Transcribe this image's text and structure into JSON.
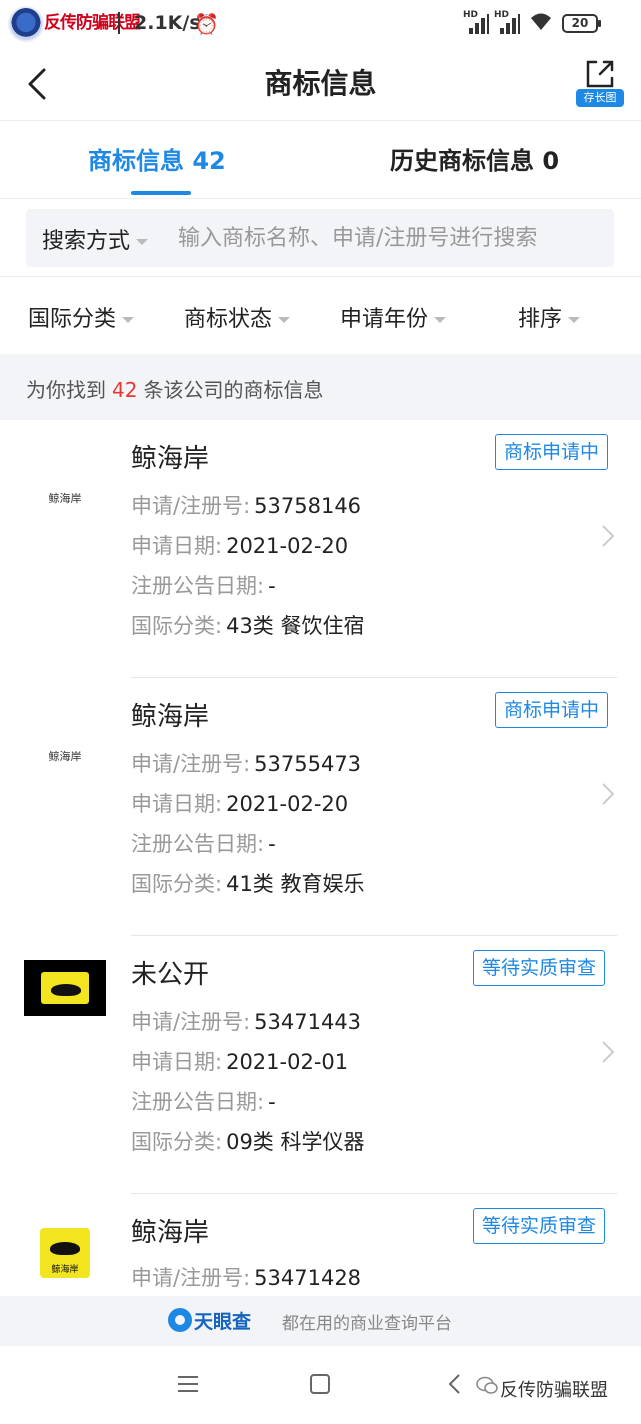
{
  "status_bar": {
    "brand": "反传防骗联盟",
    "speed": "2.1K/s",
    "alarm_icon": "alarm-clock-icon",
    "signal_label": "HD",
    "battery": "20"
  },
  "header": {
    "title": "商标信息",
    "share_label": "存长图"
  },
  "tabs": {
    "active": "商标信息 42",
    "inactive": "历史商标信息 0"
  },
  "search": {
    "mode": "搜索方式",
    "placeholder": "输入商标名称、申请/注册号进行搜索"
  },
  "filters": [
    "国际分类",
    "商标状态",
    "申请年份",
    "排序"
  ],
  "summary": {
    "prefix": "为你找到",
    "count": "42",
    "suffix": "条该公司的商标信息"
  },
  "labels": {
    "reg_no": "申请/注册号:",
    "apply_date": "申请日期:",
    "announce_date": "注册公告日期:",
    "intl_class": "国际分类:"
  },
  "items": [
    {
      "logo_text": "鲸海岸",
      "name": "鲸海岸",
      "status": "商标申请中",
      "reg_no": "53758146",
      "apply_date": "2021-02-20",
      "announce_date": "-",
      "intl_class": "43类 餐饮住宿"
    },
    {
      "logo_text": "鲸海岸",
      "name": "鲸海岸",
      "status": "商标申请中",
      "reg_no": "53755473",
      "apply_date": "2021-02-20",
      "announce_date": "-",
      "intl_class": "41类 教育娱乐"
    },
    {
      "name": "未公开",
      "status": "等待实质审查",
      "reg_no": "53471443",
      "apply_date": "2021-02-01",
      "announce_date": "-",
      "intl_class": "09类 科学仪器"
    },
    {
      "logo_text": "鲸海岸",
      "name": "鲸海岸",
      "status": "等待实质审查",
      "reg_no": "53471428"
    }
  ],
  "footer": {
    "brand": "天眼查",
    "slogan": "都在用的商业查询平台"
  },
  "watermark": "反传防骗联盟",
  "colors": {
    "accent": "#1e88e5",
    "count_red": "#e53935",
    "logo_yellow": "#f2e51f"
  }
}
